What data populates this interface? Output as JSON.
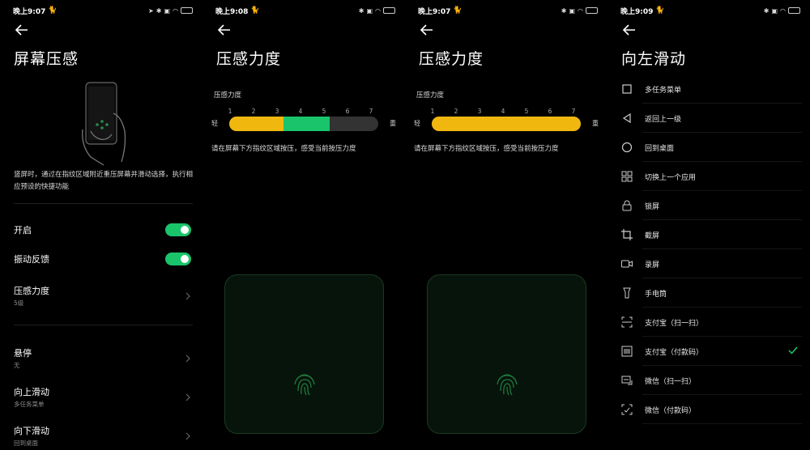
{
  "screen1": {
    "status": {
      "time": "晚上9:07"
    },
    "title": "屏幕压感",
    "description": "竖屏时，通过在指纹区域附近重压屏幕并滑动选择，执行相应预设的快捷功能",
    "enable_label": "开启",
    "vibration_label": "振动反馈",
    "pressure_label": "压感力度",
    "pressure_value": "5级",
    "hover_label": "悬停",
    "hover_value": "无",
    "swipe_up_label": "向上滑动",
    "swipe_up_value": "多任务菜单",
    "swipe_down_label": "向下滑动",
    "swipe_down_value": "回到桌面",
    "enable_on": true,
    "vibration_on": true
  },
  "screen2": {
    "status": {
      "time": "晚上9:08"
    },
    "title": "压感力度",
    "section_label": "压感力度",
    "scale": [
      "1",
      "2",
      "3",
      "4",
      "5",
      "6",
      "7"
    ],
    "light": "轻",
    "heavy": "重",
    "selected_level": 5,
    "pressed_level": 3,
    "hint": "请在屏幕下方指纹区域按压，感受当前按压力度"
  },
  "screen3": {
    "status": {
      "time": "晚上9:07"
    },
    "title": "压感力度",
    "section_label": "压感力度",
    "scale": [
      "1",
      "2",
      "3",
      "4",
      "5",
      "6",
      "7"
    ],
    "light": "轻",
    "heavy": "重",
    "selected_level": 7,
    "hint": "请在屏幕下方指纹区域按压，感受当前按压力度"
  },
  "screen4": {
    "status": {
      "time": "晚上9:09"
    },
    "title": "向左滑动",
    "items": [
      {
        "label": "多任务菜单",
        "icon": "square-icon"
      },
      {
        "label": "返回上一级",
        "icon": "back-triangle-icon"
      },
      {
        "label": "回到桌面",
        "icon": "circle-icon"
      },
      {
        "label": "切换上一个应用",
        "icon": "switch-app-icon"
      },
      {
        "label": "锁屏",
        "icon": "lock-icon"
      },
      {
        "label": "截屏",
        "icon": "crop-icon"
      },
      {
        "label": "录屏",
        "icon": "video-icon"
      },
      {
        "label": "手电筒",
        "icon": "flashlight-icon"
      },
      {
        "label": "支付宝（扫一扫）",
        "icon": "scan-icon"
      },
      {
        "label": "支付宝（付款码）",
        "icon": "barcode-icon"
      },
      {
        "label": "微信（扫一扫）",
        "icon": "wechat-scan-icon"
      },
      {
        "label": "微信（付款码）",
        "icon": "wechat-pay-icon"
      }
    ],
    "selected_index": 9
  },
  "colors": {
    "accent_green": "#19c46b",
    "bar_yellow": "#f0b70f",
    "bar_gray": "#333333"
  }
}
